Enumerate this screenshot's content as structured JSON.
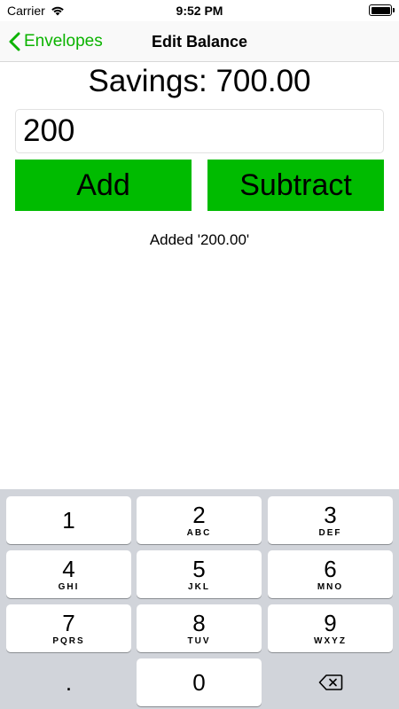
{
  "status_bar": {
    "carrier": "Carrier",
    "time": "9:52 PM",
    "wifi_icon": "wifi-icon",
    "battery_icon": "battery-icon"
  },
  "nav": {
    "back_label": "Envelopes",
    "back_icon": "chevron-left-icon",
    "title": "Edit Balance"
  },
  "balance": {
    "title": "Savings: 700.00"
  },
  "amount_input": {
    "value": "200"
  },
  "actions": {
    "add_label": "Add",
    "subtract_label": "Subtract"
  },
  "status_message": "Added '200.00'",
  "keyboard": {
    "keys": [
      {
        "digit": "1",
        "letters": ""
      },
      {
        "digit": "2",
        "letters": "ABC"
      },
      {
        "digit": "3",
        "letters": "DEF"
      },
      {
        "digit": "4",
        "letters": "GHI"
      },
      {
        "digit": "5",
        "letters": "JKL"
      },
      {
        "digit": "6",
        "letters": "MNO"
      },
      {
        "digit": "7",
        "letters": "PQRS"
      },
      {
        "digit": "8",
        "letters": "TUV"
      },
      {
        "digit": "9",
        "letters": "WXYZ"
      },
      {
        "digit": ".",
        "letters": ""
      },
      {
        "digit": "0",
        "letters": ""
      }
    ],
    "delete_icon": "backspace-icon"
  },
  "colors": {
    "accent": "#0bb300",
    "button": "#00bb00",
    "keyboard_bg": "#d1d4da"
  }
}
